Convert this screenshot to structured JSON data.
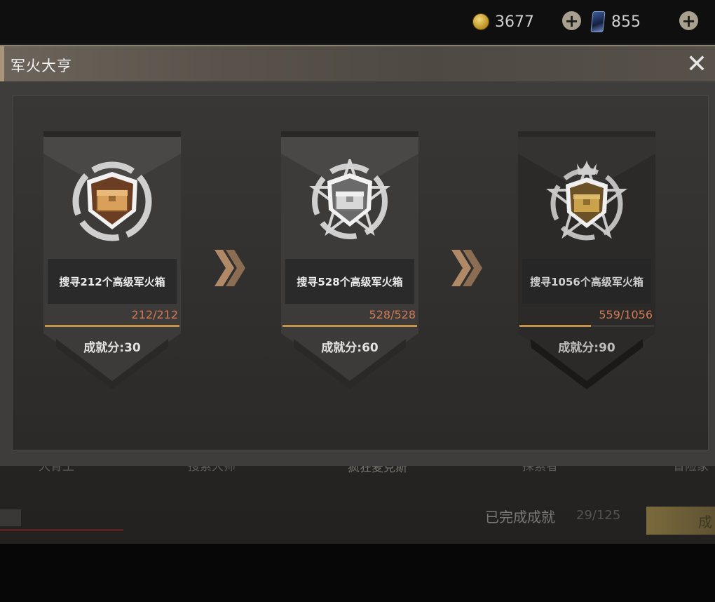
{
  "currency": {
    "coins": "3677",
    "coin_add": "+",
    "cards": "855",
    "card_add": "+"
  },
  "modal": {
    "title": "军火大亨",
    "close": "✕"
  },
  "achievements": [
    {
      "desc": "搜寻212个高级军火箱",
      "progress": "212/212",
      "fill": 1.0,
      "score": "成就分:30",
      "tier": "bronze"
    },
    {
      "desc": "搜寻528个高级军火箱",
      "progress": "528/528",
      "fill": 1.0,
      "score": "成就分:60",
      "tier": "silver"
    },
    {
      "desc": "搜寻1056个高级军火箱",
      "progress": "559/1056",
      "fill": 0.53,
      "score": "成就分:90",
      "tier": "gold"
    }
  ],
  "background": {
    "labels": [
      "大胃王",
      "搜索大师",
      "疯狂麦克斯",
      "探索者",
      "冒险家"
    ]
  },
  "footer": {
    "completed_label": "已完成成就",
    "completed_count": "29/125",
    "button_fragment": "成"
  },
  "colors": {
    "progress_text": "#d27a55",
    "progress_fill": "#c3944a",
    "bronze": "#c58a4d",
    "silver": "#cfcfcf",
    "gold": "#c9a24b"
  }
}
